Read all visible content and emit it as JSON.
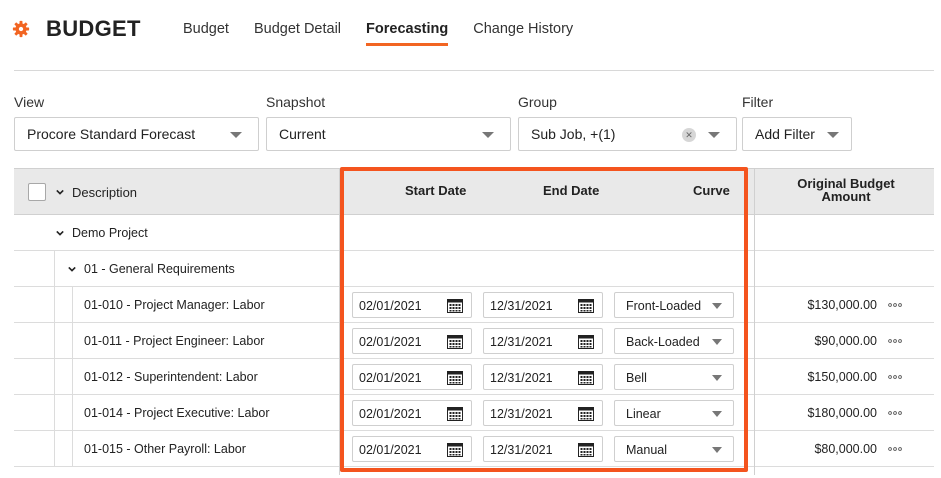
{
  "app": {
    "title": "BUDGET"
  },
  "tabs": [
    {
      "label": "Budget",
      "active": false
    },
    {
      "label": "Budget Detail",
      "active": false
    },
    {
      "label": "Forecasting",
      "active": true
    },
    {
      "label": "Change History",
      "active": false
    }
  ],
  "filters": {
    "view": {
      "label": "View",
      "value": "Procore Standard Forecast"
    },
    "snapshot": {
      "label": "Snapshot",
      "value": "Current"
    },
    "group": {
      "label": "Group",
      "value": "Sub Job, +(1)"
    },
    "filter": {
      "label": "Filter",
      "value": "Add Filter"
    }
  },
  "table": {
    "headers": {
      "description": "Description",
      "start_date": "Start Date",
      "end_date": "End Date",
      "curve": "Curve",
      "original_budget_line1": "Original Budget",
      "original_budget_line2": "Amount"
    },
    "groups": {
      "project": "Demo Project",
      "division": "01 - General Requirements"
    },
    "rows": [
      {
        "description": "01-010 - Project Manager: Labor",
        "start": "02/01/2021",
        "end": "12/31/2021",
        "curve": "Front-Loaded",
        "amount": "$130,000.00"
      },
      {
        "description": "01-011 - Project Engineer: Labor",
        "start": "02/01/2021",
        "end": "12/31/2021",
        "curve": "Back-Loaded",
        "amount": "$90,000.00"
      },
      {
        "description": "01-012 - Superintendent: Labor",
        "start": "02/01/2021",
        "end": "12/31/2021",
        "curve": "Bell",
        "amount": "$150,000.00"
      },
      {
        "description": "01-014 - Project Executive: Labor",
        "start": "02/01/2021",
        "end": "12/31/2021",
        "curve": "Linear",
        "amount": "$180,000.00"
      },
      {
        "description": "01-015 - Other Payroll: Labor",
        "start": "02/01/2021",
        "end": "12/31/2021",
        "curve": "Manual",
        "amount": "$80,000.00"
      }
    ]
  },
  "colors": {
    "accent": "#f26522",
    "highlight": "#f4541e",
    "header_bg": "#e9e9e9"
  }
}
